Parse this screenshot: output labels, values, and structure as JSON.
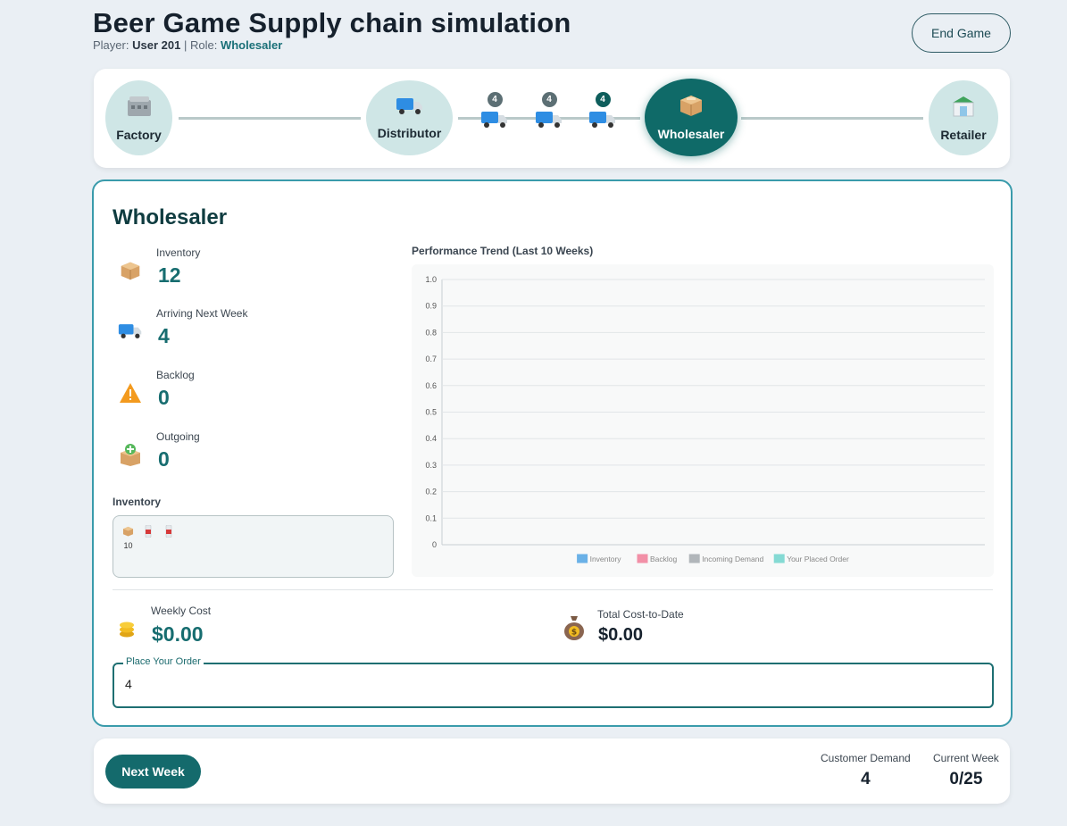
{
  "header": {
    "title": "Beer Game Supply chain simulation",
    "player_label": "Player:",
    "player_name": "User 201",
    "separator": "|",
    "role_label": "Role:",
    "role_name": "Wholesaler",
    "end_button": "End Game"
  },
  "chain": {
    "nodes": [
      {
        "label": "Factory",
        "icon": "factory-icon"
      },
      {
        "label": "Distributor",
        "icon": "truck-icon"
      },
      {
        "label": "Wholesaler",
        "icon": "box-icon",
        "active": true
      },
      {
        "label": "Retailer",
        "icon": "store-icon"
      }
    ],
    "shipments": [
      {
        "qty": "4",
        "icon": "truck-icon"
      },
      {
        "qty": "4",
        "icon": "truck-icon"
      },
      {
        "qty": "4",
        "icon": "truck-icon"
      }
    ]
  },
  "panel": {
    "title": "Wholesaler",
    "metrics": [
      {
        "label": "Inventory",
        "value": "12",
        "icon": "box-icon"
      },
      {
        "label": "Arriving Next Week",
        "value": "4",
        "icon": "truck-icon"
      },
      {
        "label": "Backlog",
        "value": "0",
        "icon": "warning-icon"
      },
      {
        "label": "Outgoing",
        "value": "0",
        "icon": "outgoing-box-icon"
      }
    ],
    "inventory_section_label": "Inventory",
    "inventory_items": [
      {
        "icon": "box-icon",
        "count": "10"
      },
      {
        "icon": "bottle-icon",
        "count": ""
      },
      {
        "icon": "bottle-icon",
        "count": ""
      }
    ],
    "weekly_cost_label": "Weekly Cost",
    "weekly_cost_value": "$0.00",
    "total_cost_label": "Total Cost-to-Date",
    "total_cost_value": "$0.00",
    "order_field_label": "Place Your Order",
    "order_field_value": "4"
  },
  "chart_data": {
    "type": "line",
    "title": "Performance Trend (Last 10 Weeks)",
    "xlabel": "",
    "ylabel": "",
    "ylim": [
      0,
      1.0
    ],
    "yticks": [
      "0",
      "0.1",
      "0.2",
      "0.3",
      "0.4",
      "0.5",
      "0.6",
      "0.7",
      "0.8",
      "0.9",
      "1.0"
    ],
    "x": [],
    "grid": true,
    "legend_position": "bottom",
    "series": [
      {
        "name": "Inventory",
        "values": [],
        "color": "#3b9ae1"
      },
      {
        "name": "Backlog",
        "values": [],
        "color": "#f06d8c"
      },
      {
        "name": "Incoming Demand",
        "values": [],
        "color": "#9aa0a6"
      },
      {
        "name": "Your Placed Order",
        "values": [],
        "color": "#5fd0c8"
      }
    ]
  },
  "footer": {
    "next_button": "Next Week",
    "customer_demand_label": "Customer Demand",
    "customer_demand_value": "4",
    "current_week_label": "Current Week",
    "current_week_value": "0/25"
  },
  "colors": {
    "accent": "#146a6c",
    "active_node": "#0f6a68",
    "node_bg": "#cfe6e6",
    "card_border": "#3a9bab"
  }
}
